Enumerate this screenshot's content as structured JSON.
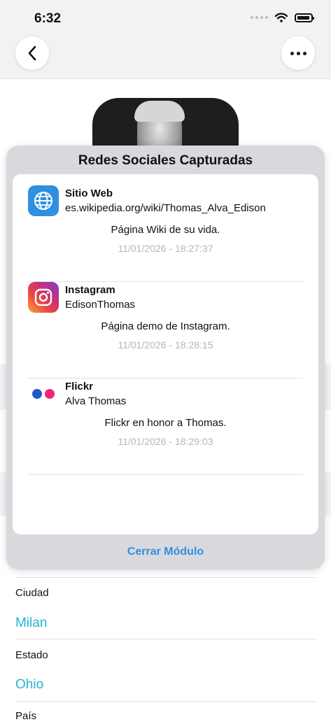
{
  "status_bar": {
    "time": "6:32"
  },
  "sheet": {
    "title": "Redes Sociales Capturadas",
    "items": [
      {
        "network": "Sitio Web",
        "handle": "es.wikipedia.org/wiki/Thomas_Alva_Edison",
        "description": "Página Wiki de su vida.",
        "timestamp": "11/01/2026 - 18:27:37",
        "icon": "globe-icon"
      },
      {
        "network": "Instagram",
        "handle": "EdisonThomas",
        "description": "Página demo de Instagram.",
        "timestamp": "11/01/2026 - 18:28:15",
        "icon": "instagram-icon"
      },
      {
        "network": "Flickr",
        "handle": "Alva Thomas",
        "description": "Flickr en honor a Thomas.",
        "timestamp": "11/01/2026 - 18:29:03",
        "icon": "flickr-icon"
      }
    ],
    "close_label": "Cerrar Módulo"
  },
  "details": {
    "city_label": "Ciudad",
    "city_value": "Milan",
    "state_label": "Estado",
    "state_value": "Ohio",
    "country_label": "País"
  },
  "colors": {
    "accent": "#2f8fe0",
    "value_text": "#27b4d3"
  }
}
